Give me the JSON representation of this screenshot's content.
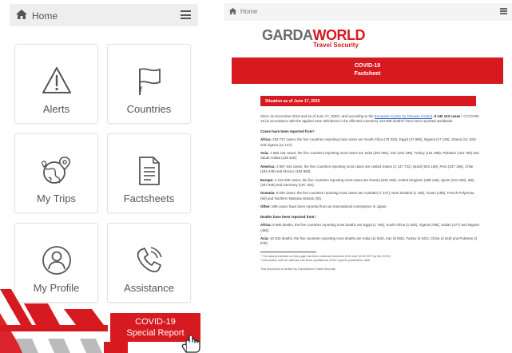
{
  "left_app": {
    "header": {
      "home_label": "Home"
    },
    "tiles": [
      {
        "label": "Alerts",
        "icon": "alert-icon"
      },
      {
        "label": "Countries",
        "icon": "flag-icon"
      },
      {
        "label": "My Trips",
        "icon": "globe-pin-icon"
      },
      {
        "label": "Factsheets",
        "icon": "document-icon"
      },
      {
        "label": "My Profile",
        "icon": "profile-icon"
      },
      {
        "label": "Assistance",
        "icon": "phone-icon"
      }
    ],
    "cta": {
      "line1": "COVID-19",
      "line2": "Special Report"
    },
    "colors": {
      "brand_red": "#d71920",
      "tile_border": "#e3e3e3"
    }
  },
  "right_doc": {
    "header": {
      "home_label": "Home"
    },
    "logo": {
      "part1": "GARDA",
      "part2": "WORLD",
      "subtitle": "Travel Security"
    },
    "banner": {
      "line1": "COVID-19",
      "line2": "Factsheet"
    },
    "situation": "Situation as of June 17, 2020",
    "intro": {
      "pre": "Since 31 December 2019 and as of June 17, 2020,¹ and according to the ",
      "link": "European Centre for Disease Control",
      "mid": ", ",
      "cases": "8 142 123 cases",
      "post": " ² of COVID-19 (in accordance with the applied case definitions in the affected countries) 443 608 deaths² have been reported worldwide."
    },
    "cases_heading": "Cases have been reported from¹:",
    "cases": [
      {
        "region": "Africa:",
        "text": " 253 737 cases; the five countries reporting most cases are South Africa (76 334), Egypt (47 856), Nigeria (17 148), Ghana (12 193) and Algeria (11 147)."
      },
      {
        "region": "Asia:",
        "text": " 1 668 125 cases; the five countries reporting most cases are India (354 065), Iran (192 439), Turkey (181 298), Pakistan (154 760) and Saudi Arabia (136 315)."
      },
      {
        "region": "America:",
        "text": " 3 987 543 cases; the five countries reporting most cases are United States (2 137 731), Brazil (923 189), Peru (237 156), Chile (184 449) and Mexico (154 863)."
      },
      {
        "region": "Europe:",
        "text": " 2 218 200 cases; the five countries reporting most cases are Russia (545 458), United Kingdom (298 136), Spain (244 328), Italy (237 500) and Germany (187 184)."
      },
      {
        "region": "Oceania:",
        "text": " 8 826 cases; the five countries reporting most cases are Australia (7 347), New Zealand (1 156), Guam (188), French Polynesia (60) and Northern Mariana Islands (30)."
      },
      {
        "region": "Other:",
        "text": " 696 cases have been reported from an international conveyance in Japan."
      }
    ],
    "deaths_heading": "Deaths have been reported from¹:",
    "deaths": [
      {
        "region": "Africa:",
        "text": " 6 996 deaths; the five countries reporting most deaths are Egypt (1 766), South Africa (1 625), Algeria (788), Sudan (477) and Nigeria (455)."
      },
      {
        "region": "Asia:",
        "text": " 43 343 deaths; the five countries reporting most deaths are India (11 903), Iran (9 065), Turkey (4 842), China (4 645) and Pakistan (2 975)."
      }
    ],
    "footnotes": [
      "¹ The data presented on this page has been collected between 6:00 and 10:00 CET by the ECDC",
      "² Information with an asterisk has been updated as of the report's publication date."
    ],
    "footer": "This document is written by GardaWorld Travel Security."
  }
}
